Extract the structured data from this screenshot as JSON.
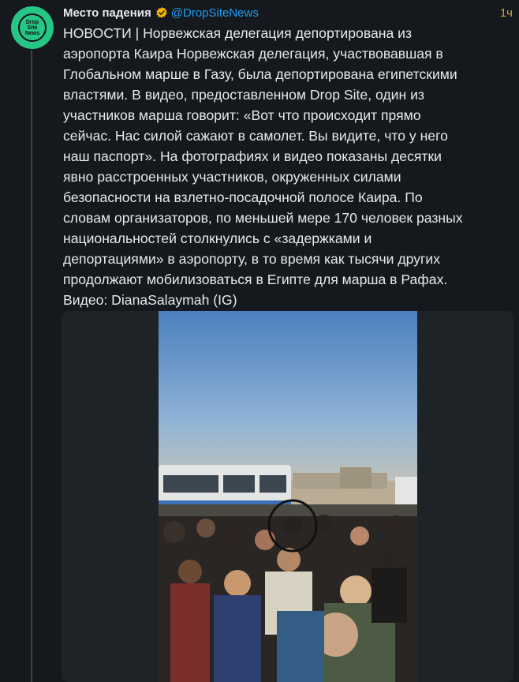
{
  "tweet": {
    "avatar_text": [
      "Drop",
      "Site",
      "News"
    ],
    "author": "Место падения",
    "handle": "@DropSiteNews",
    "time": "1ч",
    "text": "НОВОСТИ | Норвежская делегация депортирована из\nаэропорта Каира Норвежская делегация, участвовавшая в\nГлобальном марше в Газу, была депортирована египетскими\nвластями. В видео, предоставленном Drop Site, один из\nучастников марша говорит: «Вот что происходит прямо\nсейчас. Нас силой сажают в самолет. Вы видите, что у него\nнаш паспорт». На фотографиях и видео показаны десятки\nявно расстроенных участников, окруженных силами\nбезопасности на взлетно-посадочной полосе Каира. По\nсловам организаторов, по меньшей мере 170 человек разных\nнациональностей столкнулись с «задержками и\nдепортациями» в аэропорту, в то время как тысячи других\nпродолжают мобилизоваться в Египте для марша в Рафах.\nВидео: DianaSalaymah (IG)"
  },
  "colors": {
    "background": "#15191d",
    "handle": "#1d9bf0",
    "avatar": "#26c686",
    "verified": "#f4b400"
  },
  "icons": {
    "verified": "verified-badge-icon"
  }
}
